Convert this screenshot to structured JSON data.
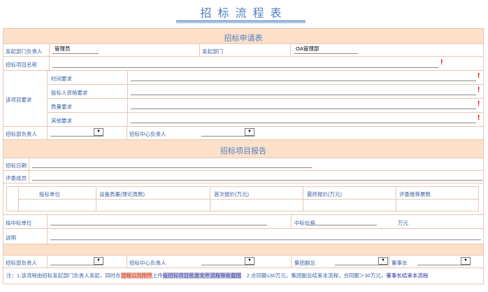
{
  "page_title": "招标流程表",
  "sections": {
    "application": "招标申请表",
    "report": "招标项目报告"
  },
  "fields": {
    "dept_head_label": "发起部门负责人",
    "dept_head_value": "管理员",
    "dept_label": "发起部门",
    "dept_value": "OA管理部",
    "project_name_label": "招标项目名称",
    "requirements_label": "该项目要求",
    "time_req_label": "时间要求",
    "qualification_req_label": "投标人资格要求",
    "quality_req_label": "质量要求",
    "other_req_label": "其他要求",
    "bid_dept_head_label": "招标部负责人",
    "bid_center_head_label": "招标中心负责人",
    "bid_date_label": "招标日期",
    "review_members_label": "评委成员",
    "proposed_winner_label": "拟中标单位",
    "winning_price_label": "中标价格",
    "price_unit": "万元",
    "remarks_label": "说明",
    "group_vp_label": "集团副总",
    "chairman_label": "董事长"
  },
  "bid_table": {
    "headers": [
      "投标单位",
      "设备质量(理论周数)",
      "首次报价(万元)",
      "最终报价(万元)",
      "评委推荐票数"
    ]
  },
  "select_arrow": "▼",
  "required_mark": "!",
  "note": {
    "prefix": "注：1.该流程由招标发起部门负责人发起，同时在",
    "highlight1": "流程公共附件",
    "mid": "上传",
    "highlight2": "投招标项目批准文件流程审批截图",
    "suffix": "　2.合同额≤30万元，集团副总结束本流程，合同额＞30万元，",
    "end": "董事长结束本流程"
  }
}
